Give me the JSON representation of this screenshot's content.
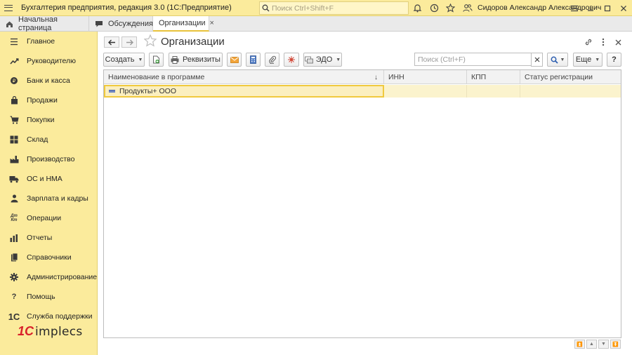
{
  "app": {
    "title": "Бухгалтерия предприятия, редакция 3.0  (1С:Предприятие)",
    "search_placeholder": "Поиск Ctrl+Shift+F",
    "user": "Сидоров Александр Александрович"
  },
  "tabs": [
    {
      "label": "Начальная страница",
      "icon": "home-icon"
    },
    {
      "label": "Обсуждения",
      "icon": "chat-icon"
    },
    {
      "label": "Организации",
      "active": true,
      "close": "×"
    }
  ],
  "sidebar": {
    "items": [
      {
        "label": "Главное",
        "icon": "menu-lines-icon"
      },
      {
        "label": "Руководителю",
        "icon": "trend-icon"
      },
      {
        "label": "Банк и касса",
        "icon": "coin-icon"
      },
      {
        "label": "Продажи",
        "icon": "bag-icon"
      },
      {
        "label": "Покупки",
        "icon": "cart-icon"
      },
      {
        "label": "Склад",
        "icon": "warehouse-icon"
      },
      {
        "label": "Производство",
        "icon": "factory-icon"
      },
      {
        "label": "ОС и НМА",
        "icon": "truck-icon"
      },
      {
        "label": "Зарплата и кадры",
        "icon": "person-icon"
      },
      {
        "label": "Операции",
        "icon": "dt-kt-icon",
        "icon_text": "Дт\nКт"
      },
      {
        "label": "Отчеты",
        "icon": "bar-chart-icon"
      },
      {
        "label": "Справочники",
        "icon": "books-icon"
      },
      {
        "label": "Администрирование",
        "icon": "gear-icon"
      },
      {
        "label": "Помощь",
        "icon": "question-icon",
        "icon_text": "?"
      },
      {
        "label": "Служба поддержки",
        "icon": "1c-icon",
        "icon_text": "1С"
      }
    ],
    "logo": {
      "mark": "1С",
      "text": "implecs"
    }
  },
  "form": {
    "title": "Организации",
    "toolbar": {
      "create": "Создать",
      "requisites": "Реквизиты",
      "edo": "ЭДО",
      "search_placeholder": "Поиск (Ctrl+F)",
      "more": "Еще",
      "help": "?"
    },
    "table": {
      "columns": [
        "Наименование в программе",
        "ИНН",
        "КПП",
        "Статус регистрации"
      ],
      "rows": [
        {
          "name": "Продукты+ ООО",
          "inn": "",
          "kpp": "",
          "status": ""
        }
      ]
    }
  },
  "colors": {
    "accent_yellow": "#fbeb9c",
    "selection_border": "#f0c93e",
    "logo_red": "#d8202a"
  }
}
